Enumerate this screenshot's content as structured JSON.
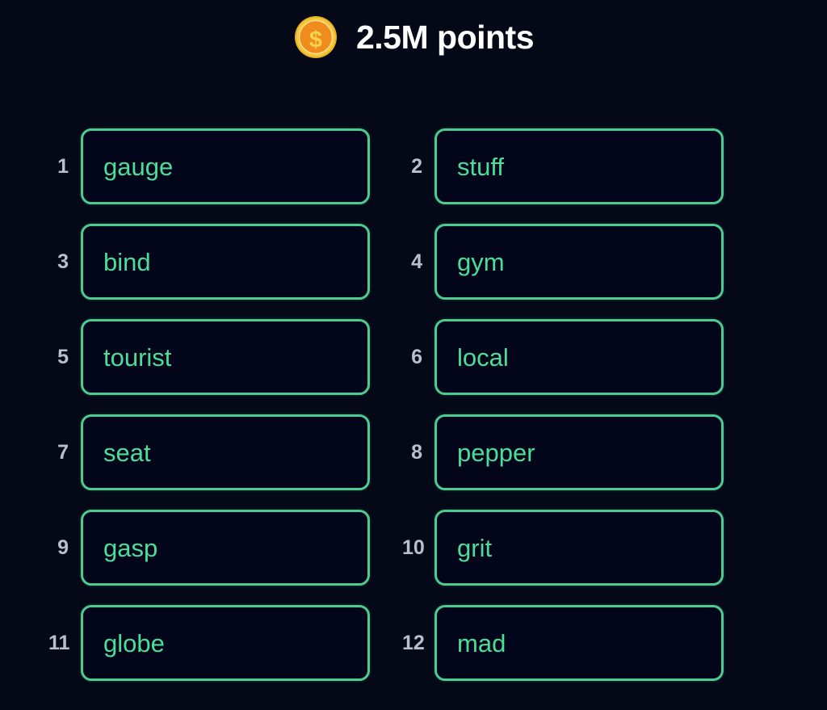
{
  "header": {
    "coin_icon": "gold-coin-dollar-icon",
    "points_label": "2.5M points",
    "points_value": "2.5M",
    "coin_colors": {
      "rim": "#f5c63a",
      "face": "#f08c1e",
      "symbol": "#f7d34a"
    }
  },
  "theme": {
    "background": "#050817",
    "box_background": "#03061a",
    "box_border": "#4ecb91",
    "word_text": "#4ade9a",
    "index_text": "#b8c0d0",
    "header_text": "#ffffff"
  },
  "word_list": {
    "columns": 2,
    "rows": 6,
    "total": 12,
    "items": [
      {
        "index": "1",
        "word": "gauge"
      },
      {
        "index": "2",
        "word": "stuff"
      },
      {
        "index": "3",
        "word": "bind"
      },
      {
        "index": "4",
        "word": "gym"
      },
      {
        "index": "5",
        "word": "tourist"
      },
      {
        "index": "6",
        "word": "local"
      },
      {
        "index": "7",
        "word": "seat"
      },
      {
        "index": "8",
        "word": "pepper"
      },
      {
        "index": "9",
        "word": "gasp"
      },
      {
        "index": "10",
        "word": "grit"
      },
      {
        "index": "11",
        "word": "globe"
      },
      {
        "index": "12",
        "word": "mad"
      }
    ]
  }
}
